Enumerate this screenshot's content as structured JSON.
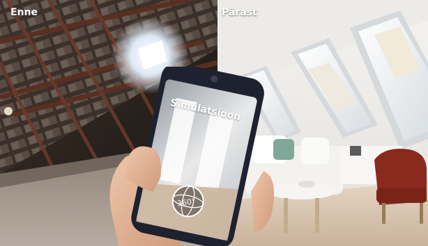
{
  "labels": {
    "before": "Enne",
    "after": "Pärast"
  },
  "phone": {
    "title": "Simulatsioon",
    "badge": "360°",
    "badge_icon": "globe-360-icon"
  },
  "colors": {
    "attic_dark": "#2a221c",
    "wall_white": "#eceae6",
    "floor_wood": "#d8c6b2",
    "armchair_red": "#8a2a1e",
    "phone_frame": "#1e2230",
    "skin": "#e6b89a"
  }
}
